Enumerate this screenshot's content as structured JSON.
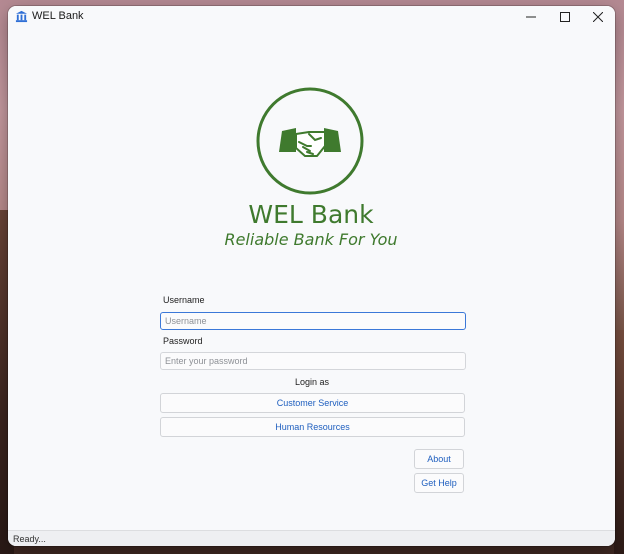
{
  "window": {
    "title": "WEL Bank",
    "icon": "bank-icon",
    "controls": [
      "minimize-icon",
      "maximize-icon",
      "close-icon"
    ]
  },
  "branding": {
    "logo_icon": "handshake-icon",
    "name": "WEL Bank",
    "tagline": "Reliable Bank For You",
    "brand_color": "#3f7a2e"
  },
  "login_form": {
    "username_label": "Username",
    "username_placeholder": "Username",
    "password_label": "Password",
    "password_placeholder": "Enter your password",
    "login_as_label": "Login as",
    "customer_service_button": "Customer Service",
    "human_resources_button": "Human Resources"
  },
  "actions": {
    "about_button": "About",
    "help_button": "Get Help"
  },
  "status_bar": {
    "text": "Ready..."
  },
  "colors": {
    "accent": "#3b78d8",
    "link_text": "#1f5fbf"
  }
}
